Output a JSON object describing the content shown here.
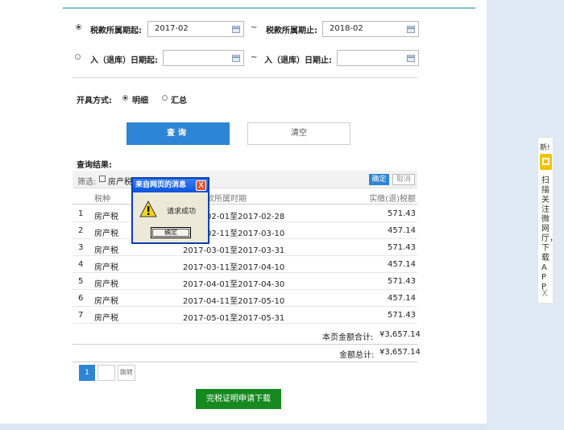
{
  "form": {
    "tax_period_start_label": "税款所属期起:",
    "tax_period_start_value": "2017-02",
    "tilde": "~",
    "tax_period_end_label": "税款所属期止:",
    "tax_period_end_value": "2018-02",
    "storage_date_start_label": "入（退库）日期起:",
    "storage_date_start_value": "",
    "storage_date_end_label": "入（退库）日期止:",
    "storage_date_end_value": "",
    "issue_mode_label": "开具方式:",
    "issue_mode_detail": "明细",
    "issue_mode_summary": "汇总",
    "query_button": "查询",
    "clear_button": "清空"
  },
  "results": {
    "title": "查询结果:",
    "filter_label": "筛选:",
    "filter_option": "房产税",
    "confirm_button": "确定",
    "cancel_button": "取消",
    "columns": {
      "tax_type": "税种",
      "period": "税款所属时期",
      "amount": "实缴(退)税额"
    },
    "rows": [
      {
        "index": "1",
        "tax_type": "房产税",
        "period": "2017-02-01至2017-02-28",
        "amount": "571.43"
      },
      {
        "index": "2",
        "tax_type": "房产税",
        "period": "2017-02-11至2017-03-10",
        "amount": "457.14"
      },
      {
        "index": "3",
        "tax_type": "房产税",
        "period": "2017-03-01至2017-03-31",
        "amount": "571.43"
      },
      {
        "index": "4",
        "tax_type": "房产税",
        "period": "2017-03-11至2017-04-10",
        "amount": "457.14"
      },
      {
        "index": "5",
        "tax_type": "房产税",
        "period": "2017-04-01至2017-04-30",
        "amount": "571.43"
      },
      {
        "index": "6",
        "tax_type": "房产税",
        "period": "2017-04-11至2017-05-10",
        "amount": "457.14"
      },
      {
        "index": "7",
        "tax_type": "房产税",
        "period": "2017-05-01至2017-05-31",
        "amount": "571.43"
      }
    ],
    "page_total_label": "本页金额合计:",
    "page_total_value": "¥3,657.14",
    "grand_total_label": "金额总计:",
    "grand_total_value": "¥3,657.14"
  },
  "pagination": {
    "current_page": "1",
    "jump_label": "跳转"
  },
  "download_button": "完税证明申请下载",
  "dialog": {
    "title": "来自网页的消息",
    "close": "X",
    "message": "请求成功",
    "ok_button": "确定"
  },
  "side_panel": {
    "new_badge": "新!",
    "text": "扫描关注微网厅，下载APP",
    "close": "X"
  },
  "colors": {
    "primary": "#2d85d5",
    "download": "#16891f",
    "dialog_title": "#0b53d9"
  }
}
